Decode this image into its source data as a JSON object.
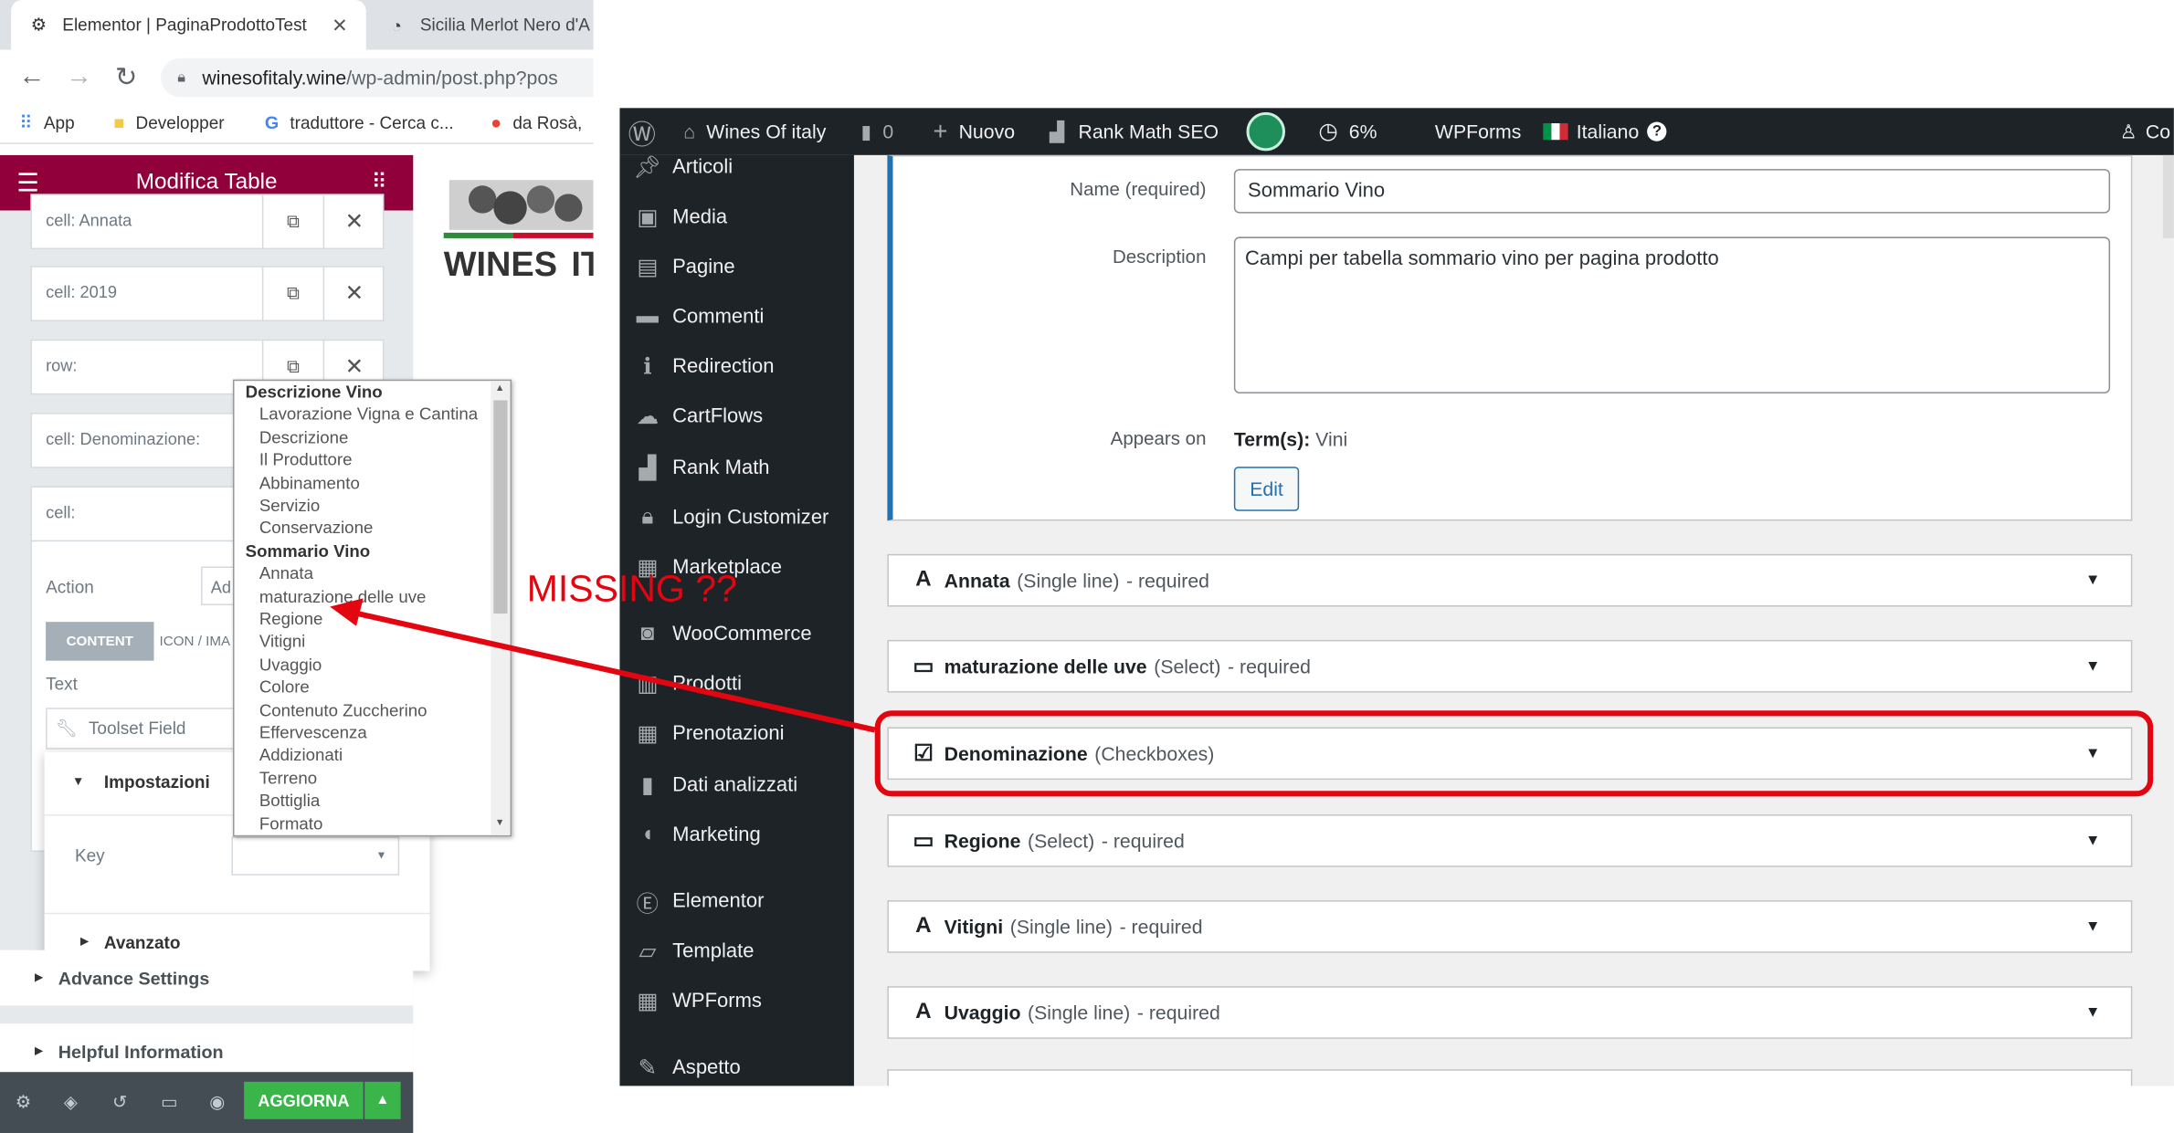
{
  "browser": {
    "tabs": [
      {
        "title": "Elementor | PaginaProdottoTest",
        "icon": "elementor-favicon"
      },
      {
        "title": "Sicilia Merlot Nero d'A",
        "icon": "site-favicon"
      }
    ],
    "url_host": "winesofitaly.wine",
    "url_path": "/wp-admin/post.php?pos",
    "bookmarks": [
      "App",
      "Developper",
      "traduttore - Cerca c...",
      "da Rosà,"
    ]
  },
  "elementor": {
    "title": "Modifica Table",
    "repeater_items": [
      "cell: Annata",
      "cell: 2019",
      "row:",
      "cell: Denominazione:",
      "cell:"
    ],
    "action_label": "Action",
    "action_value": "Ad",
    "tabs": [
      "CONTENT",
      "ICON / IMA"
    ],
    "text_label": "Text",
    "text_value": "Toolset Field",
    "popup": {
      "impostazioni": "Impostazioni",
      "key_label": "Key",
      "avanzato": "Avanzato"
    },
    "advance_settings": "Advance Settings",
    "helpful_information": "Helpful Information",
    "update_button": "AGGIORNA"
  },
  "dropdown": {
    "groups": [
      {
        "label": "Descrizione Vino",
        "options": [
          "Lavorazione Vigna e Cantina",
          "Descrizione",
          "Il Produttore",
          "Abbinamento",
          "Servizio",
          "Conservazione"
        ]
      },
      {
        "label": "Sommario Vino",
        "options": [
          "Annata",
          "maturazione delle uve",
          "Regione",
          "Vitigni",
          "Uvaggio",
          "Colore",
          "Contenuto Zuccherino",
          "Effervescenza",
          "Addizionati",
          "Terreno",
          "Bottiglia",
          "Formato"
        ]
      }
    ]
  },
  "annotation": {
    "text": "MISSING ??",
    "color": "#e3050f"
  },
  "wp_adminbar": {
    "site": "Wines Of italy",
    "comments": "0",
    "new": "Nuovo",
    "rankmath": "Rank Math SEO",
    "percent": "6%",
    "wpforms": "WPForms",
    "language": "Italiano",
    "account": "Co"
  },
  "wp_menu": [
    "Articoli",
    "Media",
    "Pagine",
    "Commenti",
    "Redirection",
    "CartFlows",
    "Rank Math",
    "Login Customizer",
    "Marketplace",
    "WooCommerce",
    "Prodotti",
    "Prenotazioni",
    "Dati analizzati",
    "Marketing",
    "Elementor",
    "Template",
    "WPForms",
    "Aspetto"
  ],
  "term_box": {
    "name_label": "Name (required)",
    "name_value": "Sommario Vino",
    "description_label": "Description",
    "description_value": "Campi per tabella sommario vino per pagina prodotto",
    "appears_label": "Appears on",
    "appears_prefix": "Term(s):",
    "appears_value": "Vini",
    "edit_button": "Edit"
  },
  "fields": [
    {
      "name": "Annata",
      "type": "(Single line)",
      "req": "- required",
      "icon": "text-icon"
    },
    {
      "name": "maturazione delle uve",
      "type": "(Select)",
      "req": "- required",
      "icon": "select-icon"
    },
    {
      "name": "Denominazione",
      "type": "(Checkboxes)",
      "req": "",
      "icon": "checkboxes-icon"
    },
    {
      "name": "Regione",
      "type": "(Select)",
      "req": "- required",
      "icon": "select-icon"
    },
    {
      "name": "Vitigni",
      "type": "(Single line)",
      "req": "- required",
      "icon": "text-icon"
    },
    {
      "name": "Uvaggio",
      "type": "(Single line)",
      "req": "- required",
      "icon": "text-icon"
    }
  ]
}
